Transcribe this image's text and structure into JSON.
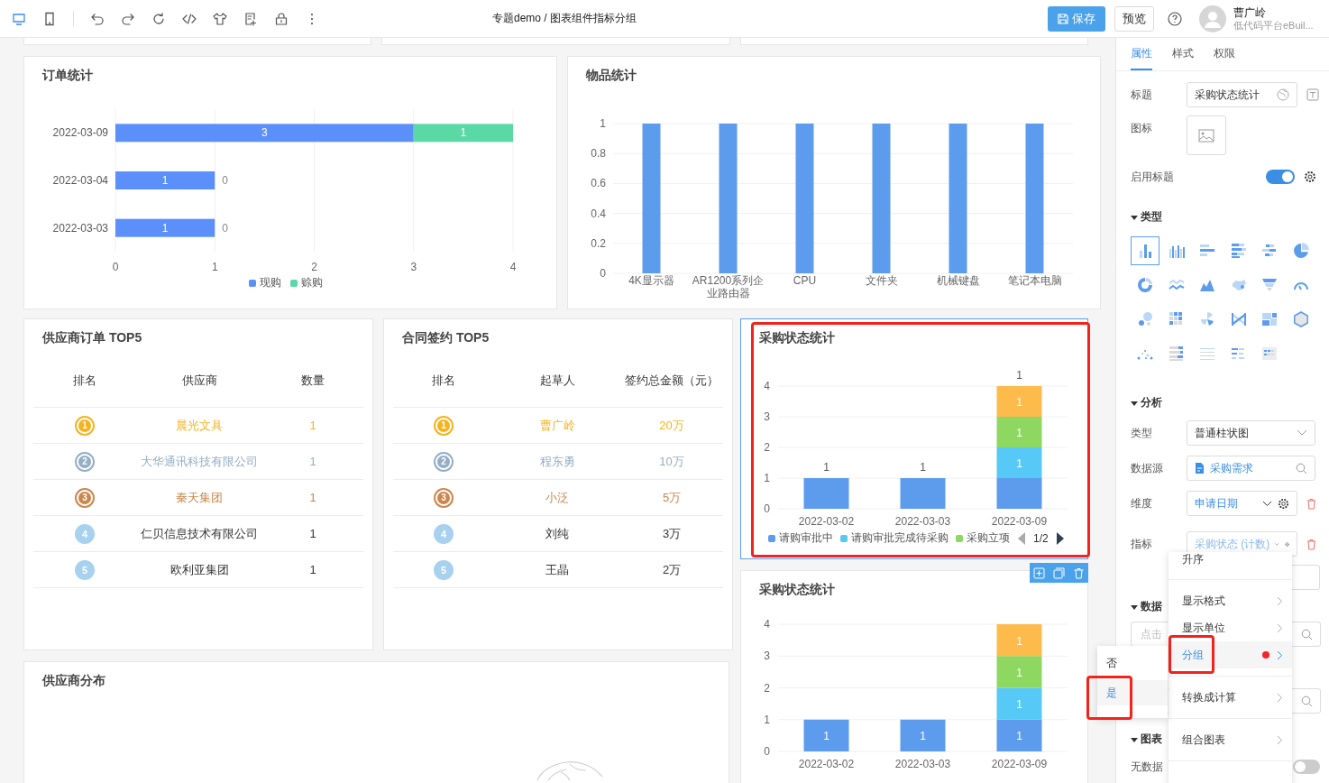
{
  "top_bar": {
    "devices": [
      {
        "kind": "desktop",
        "selected": true
      },
      {
        "kind": "mobile",
        "selected": false
      }
    ],
    "tools": [
      {
        "kind": "undo"
      },
      {
        "kind": "redo"
      },
      {
        "kind": "refresh"
      },
      {
        "kind": "code"
      },
      {
        "kind": "shirt"
      },
      {
        "kind": "add-page"
      },
      {
        "kind": "lock"
      },
      {
        "kind": "more"
      }
    ],
    "title": "专题demo / 图表组件指标分组",
    "save_button": "保存",
    "preview_button": "预览",
    "user": {
      "name": "曹广岭",
      "subtitle": "低代码平台eBuil..."
    }
  },
  "order_chart": {
    "title": "订单统计",
    "chart_data": {
      "type": "bar",
      "orientation": "horizontal",
      "stacked": true,
      "data_labels": true,
      "grid": true,
      "legend": "bottom",
      "categories": [
        "2022-03-09",
        "2022-03-04",
        "2022-03-03"
      ],
      "xlim": [
        0,
        4
      ],
      "xticks": [
        0,
        1,
        2,
        3,
        4
      ],
      "series": [
        {
          "name": "现购",
          "color": "#5b8ff9",
          "values": [
            3,
            1,
            1
          ]
        },
        {
          "name": "赊购",
          "color": "#5ad8a6",
          "values": [
            1,
            0,
            0
          ]
        }
      ]
    }
  },
  "item_chart": {
    "title": "物品统计",
    "chart_data": {
      "type": "bar",
      "orientation": "vertical",
      "data_labels": false,
      "grid": true,
      "categories": [
        "4K显示器",
        "AR1200系列企业路由器",
        "CPU",
        "文件夹",
        "机械键盘",
        "笔记本电脑"
      ],
      "ylim": [
        0,
        1
      ],
      "yticks": [
        0,
        0.2,
        0.4,
        0.6,
        0.8,
        1
      ],
      "series": [
        {
          "color": "#5d9cec",
          "values": [
            1,
            1,
            1,
            1,
            1,
            1
          ]
        }
      ]
    }
  },
  "supplier_top5": {
    "title": "供应商订单 TOP5",
    "columns": [
      "排名",
      "供应商",
      "数量"
    ],
    "rows": [
      {
        "rank": "1",
        "name": "晨光文具",
        "value": "1",
        "kind": "medal",
        "color": "#f5b31f"
      },
      {
        "rank": "2",
        "name": "大华通讯科技有限公司",
        "value": "1",
        "kind": "medal",
        "color": "#94aec5"
      },
      {
        "rank": "3",
        "name": "秦天集团",
        "value": "1",
        "kind": "medal",
        "color": "#c9874d"
      },
      {
        "rank": "4",
        "name": "仁贝信息技术有限公司",
        "value": "1",
        "kind": "plain",
        "color": "#a7d1ef"
      },
      {
        "rank": "5",
        "name": "欧利亚集团",
        "value": "1",
        "kind": "plain",
        "color": "#a7d1ef"
      }
    ]
  },
  "contract_top5": {
    "title": "合同签约 TOP5",
    "columns": [
      "排名",
      "起草人",
      "签约总金额（元）"
    ],
    "rows": [
      {
        "rank": "1",
        "name": "曹广岭",
        "value": "20万",
        "kind": "medal",
        "color": "#f5b31f"
      },
      {
        "rank": "2",
        "name": "程东勇",
        "value": "10万",
        "kind": "medal",
        "color": "#94aec5"
      },
      {
        "rank": "3",
        "name": "小泛",
        "value": "5万",
        "kind": "medal",
        "color": "#c9874d"
      },
      {
        "rank": "4",
        "name": "刘纯",
        "value": "3万",
        "kind": "plain",
        "color": "#a7d1ef"
      },
      {
        "rank": "5",
        "name": "王晶",
        "value": "2万",
        "kind": "plain",
        "color": "#a7d1ef"
      }
    ]
  },
  "status_chart_selected": {
    "title": "采购状态统计",
    "selected": true,
    "annotated": true,
    "legend_page": "1/2",
    "chart_data": {
      "type": "bar",
      "orientation": "vertical",
      "stacked": true,
      "grid": true,
      "legend": "bottom",
      "categories": [
        "2022-03-02",
        "2022-03-03",
        "2022-03-09"
      ],
      "ylim": [
        0,
        4
      ],
      "yticks": [
        0,
        1,
        2,
        3,
        4
      ],
      "series": [
        {
          "name": "请购审批中",
          "color": "#5d9cec",
          "values": [
            1,
            1,
            1
          ]
        },
        {
          "name": "请购审批完成待采购",
          "color": "#56c9f6",
          "values": [
            null,
            null,
            1
          ]
        },
        {
          "name": "采购立项",
          "color": "#8ed862",
          "values": [
            null,
            null,
            1
          ]
        },
        {
          "color": "#fdbb4c",
          "values": [
            null,
            null,
            1
          ]
        }
      ],
      "value_labels": [
        [
          null,
          null,
          null
        ],
        [
          null,
          null,
          "1"
        ],
        [
          null,
          null,
          "1"
        ],
        [
          null,
          null,
          "1"
        ]
      ],
      "annotations": [
        "1",
        "1",
        "1"
      ]
    }
  },
  "status_chart": {
    "title": "采购状态统计",
    "hovered": true,
    "chart_data": {
      "type": "bar",
      "orientation": "vertical",
      "stacked": true,
      "data_labels": true,
      "grid": true,
      "categories": [
        "2022-03-02",
        "2022-03-03",
        "2022-03-09"
      ],
      "ylim": [
        0,
        4
      ],
      "yticks": [
        0,
        1,
        2,
        3,
        4
      ],
      "series": [
        {
          "color": "#5d9cec",
          "values": [
            1,
            1,
            1
          ]
        },
        {
          "color": "#56c9f6",
          "values": [
            null,
            null,
            1
          ]
        },
        {
          "color": "#8ed862",
          "values": [
            null,
            null,
            1
          ]
        },
        {
          "color": "#fdbb4c",
          "values": [
            null,
            null,
            1
          ]
        }
      ]
    }
  },
  "supplier_map": {
    "title": "供应商分布"
  },
  "properties_panel": {
    "tabs": [
      {
        "label": "属性",
        "selected": true
      },
      {
        "label": "样式",
        "selected": false
      },
      {
        "label": "权限",
        "selected": false
      }
    ],
    "title_field": {
      "label": "标题",
      "value": "采购状态统计"
    },
    "icon_field": {
      "label": "图标"
    },
    "title_toggle": {
      "label": "启用标题",
      "on": true
    },
    "type_section": {
      "label": "类型",
      "expanded": true,
      "chart_types": [
        {
          "kind": "bar",
          "selected": true
        },
        {
          "kind": "bar-group",
          "selected": false
        },
        {
          "kind": "hbar",
          "selected": false
        },
        {
          "kind": "hbar-stack",
          "selected": false
        },
        {
          "kind": "hbar-diverge",
          "selected": false
        },
        {
          "kind": "pie",
          "selected": false
        },
        {
          "kind": "donut",
          "selected": false
        },
        {
          "kind": "line",
          "selected": false
        },
        {
          "kind": "area",
          "selected": false
        },
        {
          "kind": "map",
          "selected": false
        },
        {
          "kind": "funnel",
          "selected": false
        },
        {
          "kind": "gauge",
          "selected": false
        },
        {
          "kind": "bubble",
          "selected": false
        },
        {
          "kind": "heatmap",
          "selected": false
        },
        {
          "kind": "rose",
          "selected": false
        },
        {
          "kind": "sankey",
          "selected": false
        },
        {
          "kind": "treemap",
          "selected": false
        },
        {
          "kind": "radar",
          "selected": false
        },
        {
          "kind": "scatter",
          "selected": false
        },
        {
          "kind": "ranking",
          "selected": false
        },
        {
          "kind": "text-table",
          "selected": false
        },
        {
          "kind": "bar-list",
          "selected": false
        },
        {
          "kind": "calendar",
          "selected": false
        }
      ]
    },
    "analysis_section": {
      "label": "分析",
      "expanded": true,
      "fields": [
        {
          "kind": "select",
          "label": "类型",
          "value": "普通柱状图"
        },
        {
          "kind": "source",
          "label": "数据源",
          "value": "采购需求"
        },
        {
          "kind": "dimension",
          "label": "维度",
          "value": "申请日期"
        },
        {
          "kind": "measure",
          "label": "指标",
          "value": "采购状态 (计数)"
        },
        {
          "kind": "blank"
        }
      ]
    },
    "filter_section": {
      "label": "数据",
      "expanded": true,
      "placeholder": "点击"
    },
    "chart_section": {
      "label": "图表",
      "expanded": true,
      "no_data_toggle": {
        "label": "无数据",
        "on": false
      }
    }
  },
  "context_menu": {
    "items": [
      {
        "label": "升序",
        "has_submenu": false,
        "selected": false,
        "marked": false,
        "annotated": false,
        "divider_after": true
      },
      {
        "label": "显示格式",
        "has_submenu": true,
        "selected": false,
        "marked": false,
        "annotated": false,
        "divider_after": false
      },
      {
        "label": "显示单位",
        "has_submenu": true,
        "selected": false,
        "marked": false,
        "annotated": false,
        "divider_after": false
      },
      {
        "label": "分组",
        "has_submenu": true,
        "selected": true,
        "marked": true,
        "annotated": true,
        "divider_after": true
      },
      {
        "label": "转换成计算",
        "has_submenu": true,
        "selected": false,
        "marked": false,
        "annotated": false,
        "divider_after": true
      },
      {
        "label": "组合图表",
        "has_submenu": true,
        "selected": false,
        "marked": false,
        "annotated": false,
        "divider_after": true
      }
    ]
  },
  "submenu": {
    "items": [
      {
        "label": "否",
        "selected": false,
        "annotated": false
      },
      {
        "label": "是",
        "selected": true,
        "annotated": true
      }
    ]
  }
}
